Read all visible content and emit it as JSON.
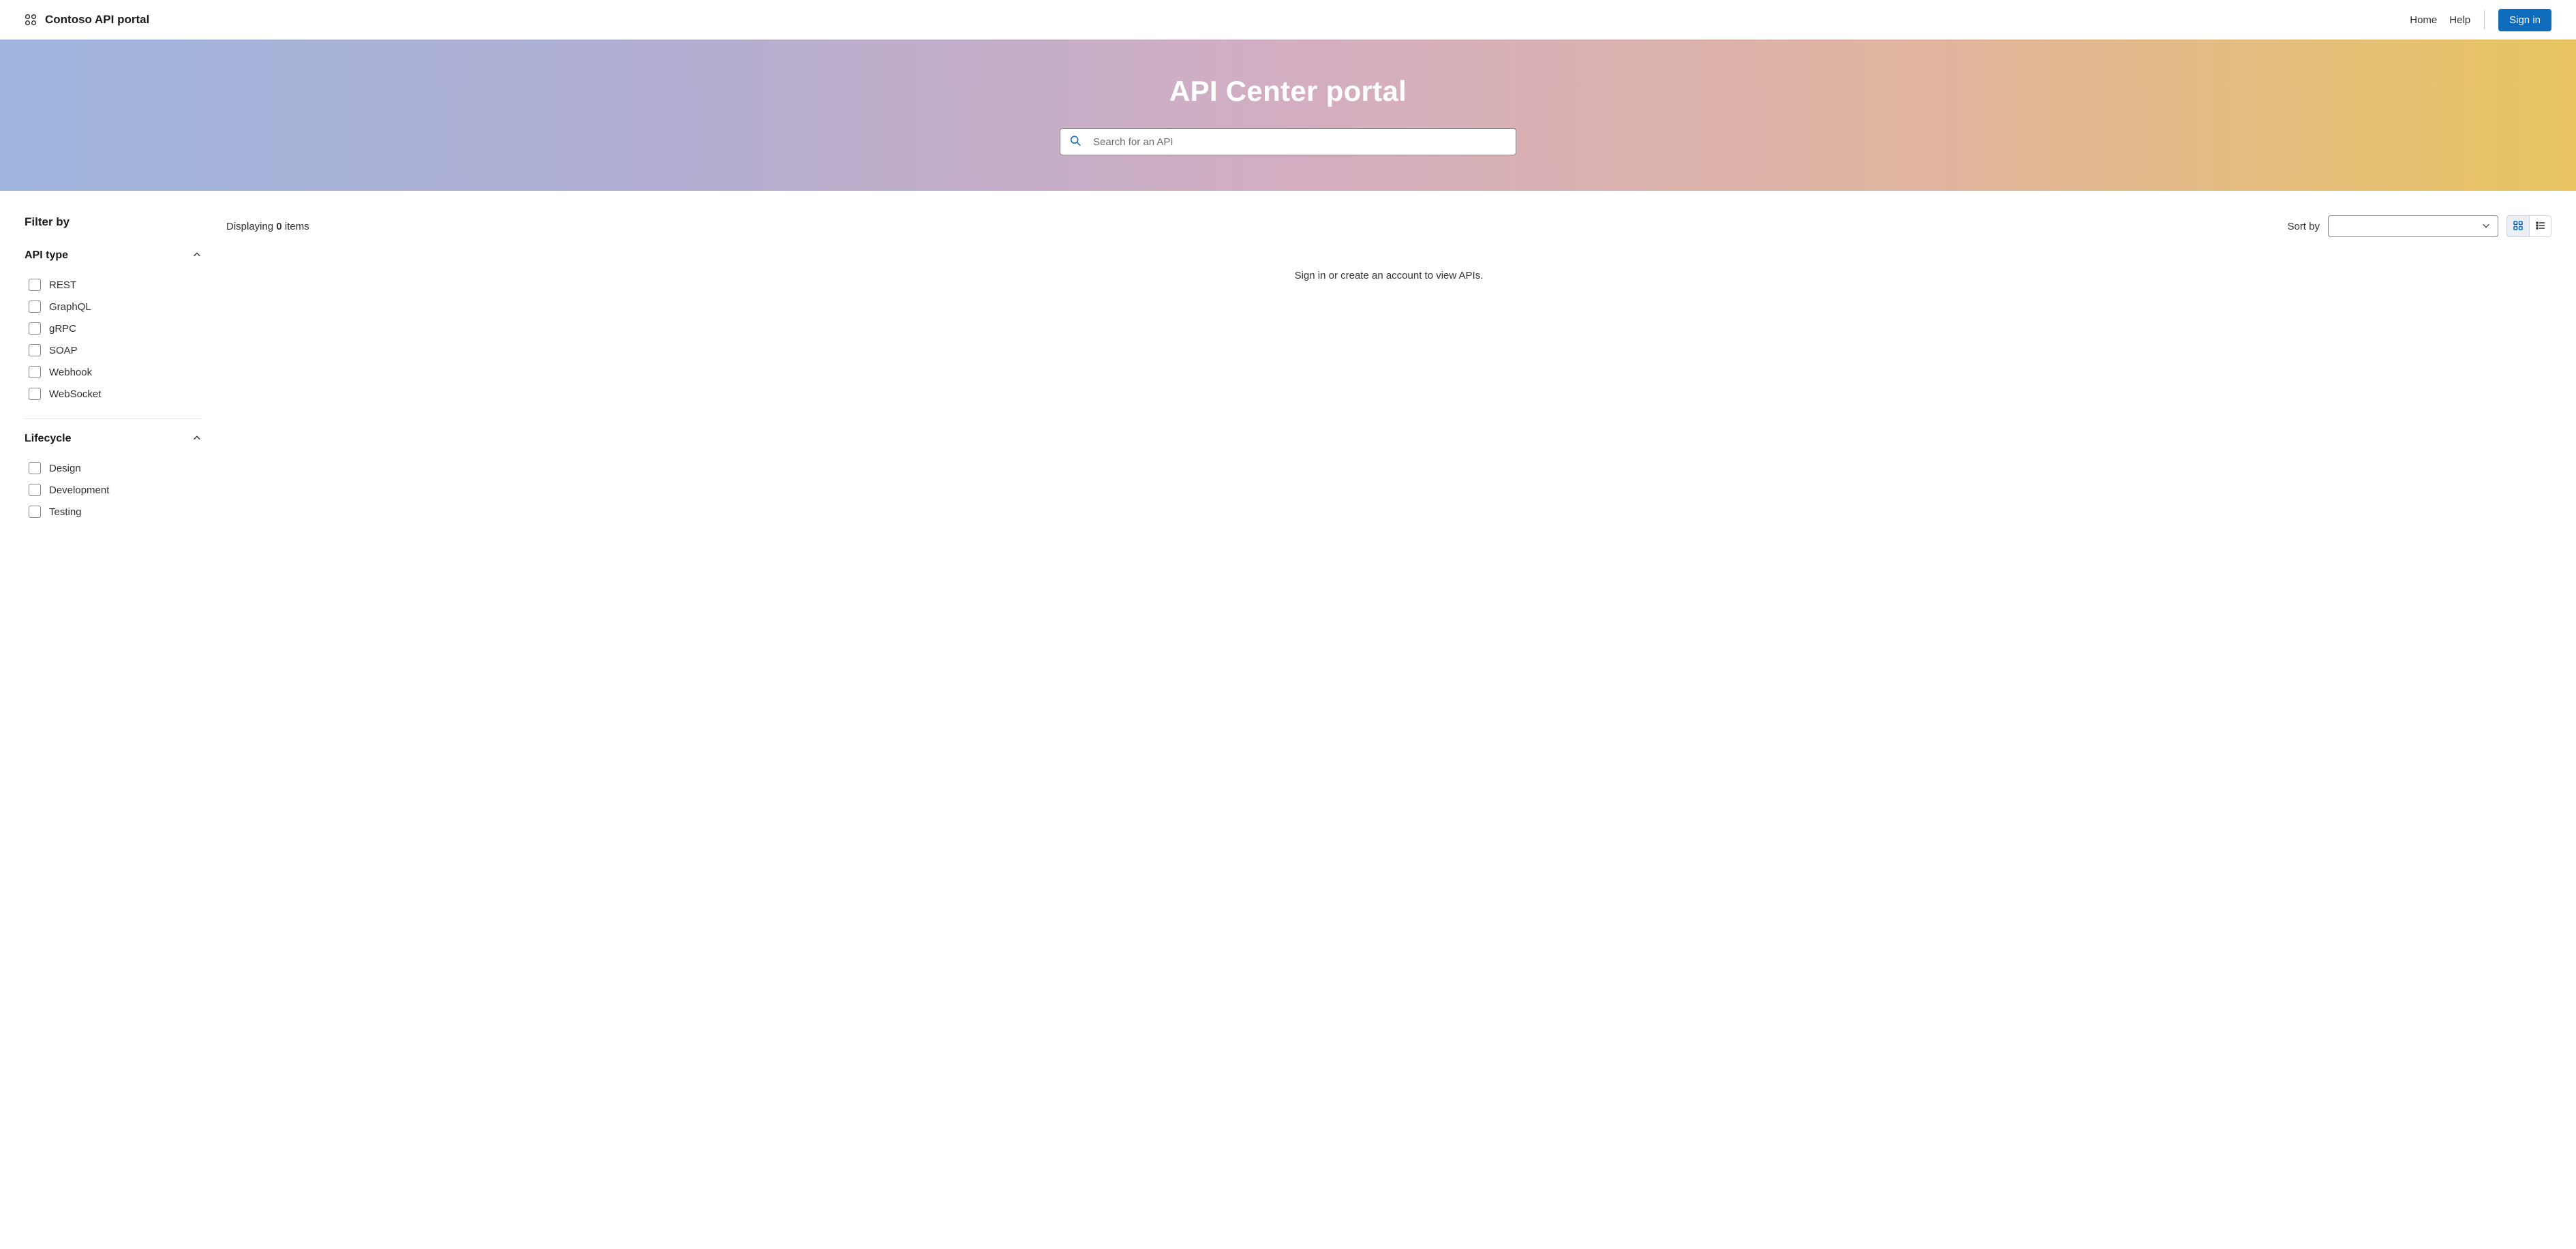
{
  "header": {
    "brand": "Contoso API portal",
    "nav": {
      "home": "Home",
      "help": "Help"
    },
    "signin": "Sign in"
  },
  "hero": {
    "title": "API Center portal",
    "search_placeholder": "Search for an API"
  },
  "sidebar": {
    "title": "Filter by",
    "sections": [
      {
        "title": "API type",
        "items": [
          "REST",
          "GraphQL",
          "gRPC",
          "SOAP",
          "Webhook",
          "WebSocket"
        ]
      },
      {
        "title": "Lifecycle",
        "items": [
          "Design",
          "Development",
          "Testing"
        ]
      }
    ]
  },
  "main": {
    "display_prefix": "Displaying ",
    "display_count": "0",
    "display_suffix": " items",
    "sort_label": "Sort by",
    "empty": "Sign in or create an account to view APIs."
  }
}
